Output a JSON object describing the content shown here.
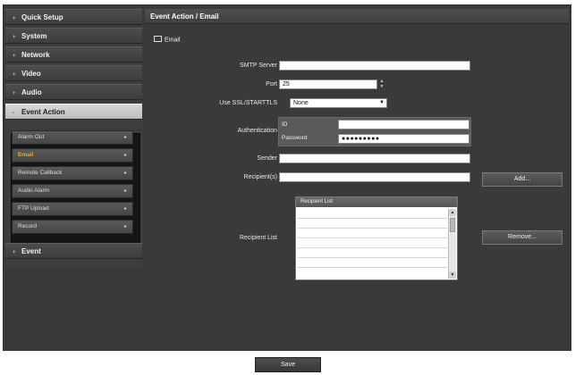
{
  "sidebar": {
    "items": [
      {
        "label": "Quick Setup"
      },
      {
        "label": "System"
      },
      {
        "label": "Network"
      },
      {
        "label": "Video"
      },
      {
        "label": "Audio"
      },
      {
        "label": "Event Action"
      },
      {
        "label": "Event"
      }
    ],
    "submenu": [
      {
        "label": "Alarm Out"
      },
      {
        "label": "Email"
      },
      {
        "label": "Remote Callback"
      },
      {
        "label": "Audio Alarm"
      },
      {
        "label": "FTP Upload"
      },
      {
        "label": "Record"
      }
    ],
    "collapsed_marker": "+",
    "expanded_marker": "-",
    "sub_arrow": "▸"
  },
  "panel": {
    "title": "Event Action / Email",
    "section": "Email"
  },
  "form": {
    "smtp_server_label": "SMTP Server",
    "smtp_server_value": "",
    "port_label": "Port",
    "port_value": "25",
    "ssl_label": "Use SSL/STARTTLS",
    "ssl_value": "None",
    "auth_label": "Authentication",
    "id_label": "ID",
    "id_value": "",
    "password_label": "Password",
    "password_value": "●●●●●●●●●",
    "sender_label": "Sender",
    "sender_value": "",
    "recipients_label": "Recipient(s)",
    "recipients_value": "",
    "add_button": "Add...",
    "recipient_list_label": "Recipient List",
    "recipient_list_header": "Recipient List",
    "remove_button": "Remove..."
  },
  "footer": {
    "save_button": "Save"
  },
  "colors": {
    "active_submenu": "#f0a63a",
    "active_menu_bg": "#c8c8c8",
    "panel_bg": "#3a3a3a"
  }
}
